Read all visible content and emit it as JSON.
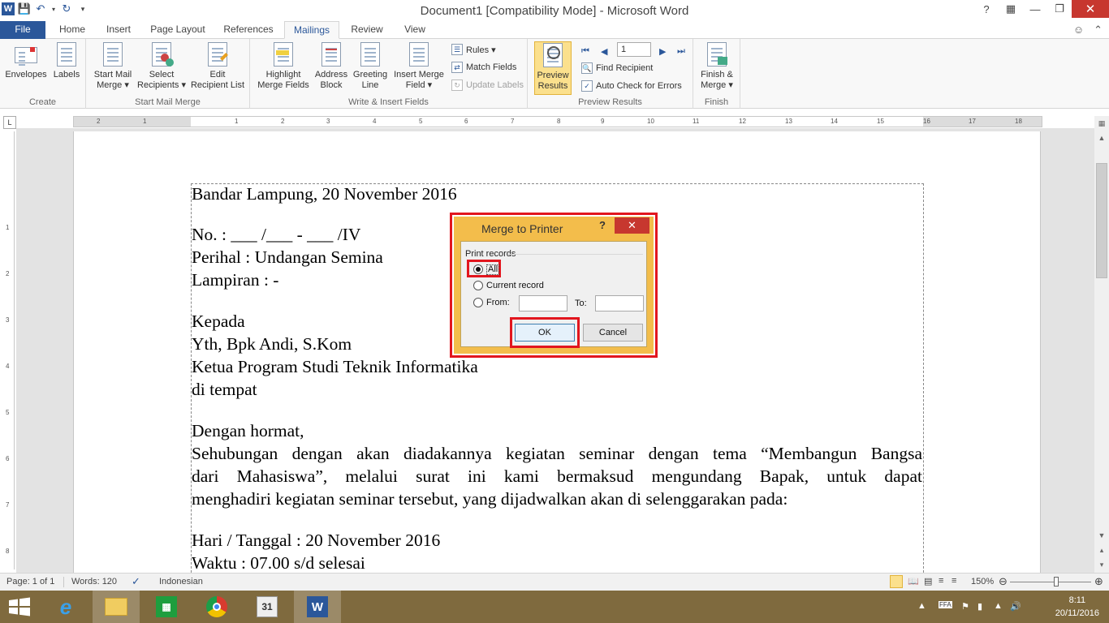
{
  "window": {
    "title": "Document1 [Compatibility Mode]  -  Microsoft Word"
  },
  "tabs": [
    {
      "label": "File"
    },
    {
      "label": "Home"
    },
    {
      "label": "Insert"
    },
    {
      "label": "Page Layout"
    },
    {
      "label": "References"
    },
    {
      "label": "Mailings"
    },
    {
      "label": "Review"
    },
    {
      "label": "View"
    }
  ],
  "ribbon": {
    "groups": {
      "create": "Create",
      "start_mail_merge": "Start Mail Merge",
      "write_insert": "Write & Insert Fields",
      "preview_results": "Preview Results",
      "finish": "Finish"
    },
    "envelopes": "Envelopes",
    "labels": "Labels",
    "start_mail_merge_1": "Start Mail",
    "start_mail_merge_2": "Merge ▾",
    "select_recipients_1": "Select",
    "select_recipients_2": "Recipients ▾",
    "edit_list_1": "Edit",
    "edit_list_2": "Recipient List",
    "highlight_1": "Highlight",
    "highlight_2": "Merge Fields",
    "address_1": "Address",
    "address_2": "Block",
    "greeting_1": "Greeting",
    "greeting_2": "Line",
    "insert_merge_1": "Insert Merge",
    "insert_merge_2": "Field ▾",
    "rules": "Rules ▾",
    "match_fields": "Match Fields",
    "update_labels": "Update Labels",
    "preview_1": "Preview",
    "preview_2": "Results",
    "record_number": "1",
    "find_recipient": "Find Recipient",
    "auto_check": "Auto Check for Errors",
    "finish_1": "Finish &",
    "finish_2": "Merge ▾"
  },
  "ruler": {
    "ticks": [
      "2",
      "1",
      "1",
      "2",
      "3",
      "4",
      "5",
      "6",
      "7",
      "8",
      "9",
      "10",
      "11",
      "12",
      "13",
      "14",
      "15",
      "16",
      "17",
      "18"
    ],
    "vticks": [
      "1",
      "2",
      "3",
      "4",
      "5",
      "6",
      "7",
      "8"
    ]
  },
  "document": {
    "lines": [
      "Bandar Lampung, 20 November 2016",
      "No.                 : ___ /___ - ___ /IV",
      "Perihal           : Undangan Semina",
      "Lampiran         : -",
      "Kepada",
      "Yth, Bpk Andi, S.Kom",
      "Ketua Program Studi Teknik Informatika",
      "di tempat",
      "Dengan hormat,",
      "Sehubungan dengan akan diadakannya kegiatan seminar dengan tema “Membangun Bangsa",
      "dari Mahasiswa”, melalui surat ini kami bermaksud mengundang Bapak, untuk dapat",
      "menghadiri kegiatan seminar tersebut, yang dijadwalkan akan di selenggarakan pada:",
      "Hari / Tanggal           : 20 November 2016",
      "Waktu                     : 07.00 s/d selesai"
    ]
  },
  "dialog": {
    "title": "Merge to Printer",
    "help": "?",
    "close": "✕",
    "group_label": "Print records",
    "all": "All",
    "current": "Current record",
    "from": "From:",
    "to": "To:",
    "ok": "OK",
    "cancel": "Cancel",
    "selected": "all"
  },
  "status": {
    "page": "Page: 1 of 1",
    "words": "Words: 120",
    "language": "Indonesian",
    "zoom": "150%"
  },
  "taskbar": {
    "clock_time": "8:11",
    "clock_date": "20/11/2016",
    "calendar_day": "31"
  },
  "colors": {
    "word_blue": "#2b579a",
    "highlight_red": "#e2161e",
    "dialog_frame": "#f3bd4b",
    "taskbar": "#7f6a3e"
  }
}
